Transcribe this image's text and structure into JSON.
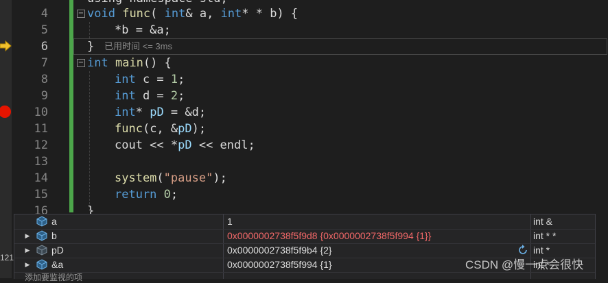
{
  "editor": {
    "partial_top_line": "using namespace std;",
    "line_numbers": [
      "4",
      "5",
      "6",
      "7",
      "8",
      "9",
      "10",
      "11",
      "12",
      "13",
      "14",
      "15",
      "16"
    ],
    "code": {
      "l4_kw": "void",
      "l4_fn": "func",
      "l4_p1": "( ",
      "l4_t1": "int",
      "l4_p2": "& a, ",
      "l4_t2": "int",
      "l4_p3": "* * b) {",
      "l5": "*b = &a;",
      "l6": "}",
      "l7_kw": "int",
      "l7_fn": "main",
      "l7_rest": "() {",
      "l8_kw": "int",
      "l8_rest": " c = ",
      "l8_num": "1",
      "l8_end": ";",
      "l9_kw": "int",
      "l9_rest": " d = ",
      "l9_num": "2",
      "l9_end": ";",
      "l10_kw": "int",
      "l10_star": "* ",
      "l10_var": "pD",
      "l10_rest": " = &d;",
      "l11_fn": "func",
      "l11_rest": "(c, &",
      "l11_var": "pD",
      "l11_end": ");",
      "l12_a": "cout << *",
      "l12_var": "pD",
      "l12_b": " << endl;",
      "l14_fn": "system",
      "l14_p1": "(",
      "l14_str": "\"pause\"",
      "l14_p2": ");",
      "l15_kw": "return",
      "l15_rest": " ",
      "l15_num": "0",
      "l15_end": ";",
      "l16": "}"
    },
    "elapsed_hint": "已用时间 <= 3ms"
  },
  "watch": {
    "rows": [
      {
        "name": "a",
        "value": "1",
        "type": "int &"
      },
      {
        "name": "b",
        "value": "0x0000002738f5f9d8 {0x0000002738f5f994 {1}}",
        "type": "int * *"
      },
      {
        "name": "pD",
        "value": "0x0000002738f5f9b4 {2}",
        "type": "int *"
      },
      {
        "name": "&a",
        "value": "0x0000002738f5f994 {1}",
        "type": "int *"
      }
    ],
    "changed_color": "#f16868"
  },
  "side_number": "121",
  "below_text": "添加要监视的项",
  "watermark": "CSDN @慢一点会很快",
  "colors": {
    "keyword": "#569cd6",
    "function": "#dcdcaa",
    "variable": "#9cdcfe",
    "number": "#b5cea8",
    "string": "#d69d85",
    "breakpoint": "#e51400",
    "change_bar": "#4ca64a"
  }
}
